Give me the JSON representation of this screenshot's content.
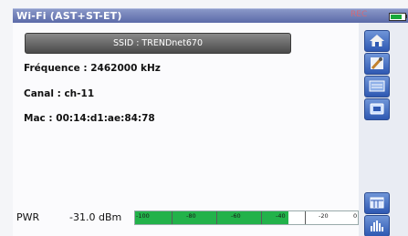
{
  "title_bar": {
    "title": "Wi-Fi (AST+ST-ET)",
    "rec_indicator": "REC"
  },
  "ssid_button": {
    "label": "SSID : TRENDnet670"
  },
  "info": {
    "frequency": "Fréquence : 2462000 kHz",
    "channel": "Canal : ch-11",
    "mac": "Mac : 00:14:d1:ae:84:78"
  },
  "power": {
    "label": "PWR",
    "value": "-31.0 dBm",
    "level_dbm": -31.0,
    "scale_min": -100,
    "scale_max": 0,
    "ticks": [
      "-100",
      "-80",
      "-60",
      "-40",
      "-20",
      "0"
    ]
  },
  "colors": {
    "accent": "#2e58b2",
    "meter_fill": "#22b24a",
    "title_bar": "#6b79b6"
  },
  "side_toolbar": {
    "icons": [
      "home-icon",
      "tools-icon",
      "settings-icon",
      "tv-icon",
      "calendar-icon",
      "spectrum-icon"
    ]
  }
}
